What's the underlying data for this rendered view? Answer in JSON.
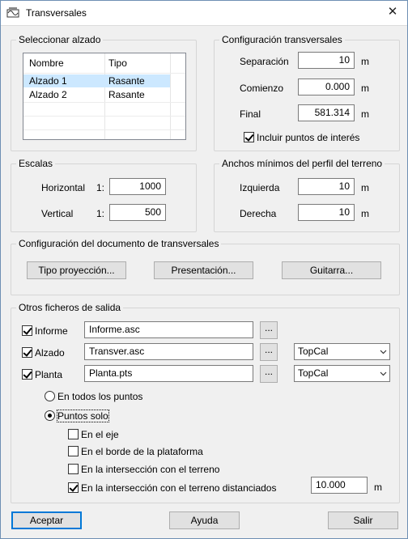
{
  "window": {
    "title": "Transversales",
    "close_glyph": "✕"
  },
  "select_alzado": {
    "label": "Seleccionar alzado",
    "columns": [
      "Nombre",
      "Tipo"
    ],
    "rows": [
      {
        "nombre": "Alzado 1",
        "tipo": "Rasante",
        "selected": true
      },
      {
        "nombre": "Alzado 2",
        "tipo": "Rasante",
        "selected": false
      }
    ]
  },
  "config_transversales": {
    "label": "Configuración transversales",
    "separacion": {
      "label": "Separación",
      "value": "10",
      "unit": "m"
    },
    "comienzo": {
      "label": "Comienzo",
      "value": "0.000",
      "unit": "m"
    },
    "final": {
      "label": "Final",
      "value": "581.314",
      "unit": "m"
    },
    "incluir": {
      "label": "Incluir puntos de interés",
      "checked": true
    }
  },
  "escalas": {
    "label": "Escalas",
    "horizontal": {
      "label": "Horizontal",
      "prefix": "1:",
      "value": "1000"
    },
    "vertical": {
      "label": "Vertical",
      "prefix": "1:",
      "value": "500"
    }
  },
  "anchos": {
    "label": "Anchos mínimos del perfil del terreno",
    "izquierda": {
      "label": "Izquierda",
      "value": "10",
      "unit": "m"
    },
    "derecha": {
      "label": "Derecha",
      "value": "10",
      "unit": "m"
    }
  },
  "documento": {
    "label": "Configuración del documento de transversales",
    "buttons": {
      "proyeccion": "Tipo proyección...",
      "presentacion": "Presentación...",
      "guitarra": "Guitarra..."
    }
  },
  "otros": {
    "label": "Otros ficheros de salida",
    "informe": {
      "label": "Informe",
      "checked": true,
      "file": "Informe.asc",
      "browse": "..."
    },
    "alzado": {
      "label": "Alzado",
      "checked": true,
      "file": "Transver.asc",
      "browse": "...",
      "format": "TopCal"
    },
    "planta": {
      "label": "Planta",
      "checked": true,
      "file": "Planta.pts",
      "browse": "...",
      "format": "TopCal"
    },
    "radio_todos": {
      "label": "En todos los puntos",
      "selected": false
    },
    "radio_solo": {
      "label": "Puntos solo",
      "selected": true
    },
    "en_eje": {
      "label": "En el eje",
      "checked": false
    },
    "en_borde": {
      "label": "En el borde de la plataforma",
      "checked": false
    },
    "en_interseccion": {
      "label": "En la intersección con el terreno",
      "checked": false
    },
    "en_interseccion_dist": {
      "label": "En la intersección con el terreno distanciados",
      "checked": true,
      "value": "10.000",
      "unit": "m"
    }
  },
  "footer": {
    "aceptar": "Aceptar",
    "ayuda": "Ayuda",
    "salir": "Salir"
  }
}
